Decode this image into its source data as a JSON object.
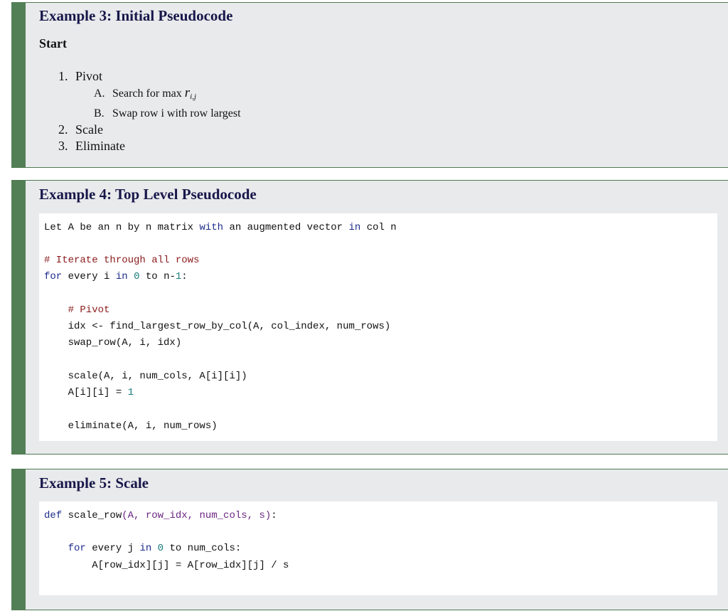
{
  "example3": {
    "title": "Example 3: Initial Pseudocode",
    "start_label": "Start",
    "steps": [
      {
        "num": "1.",
        "label": "Pivot",
        "substeps": [
          {
            "num": "A.",
            "label": "Search for max ",
            "var": "r",
            "sub": "i,j"
          },
          {
            "num": "B.",
            "label": "Swap row i with row largest"
          }
        ]
      },
      {
        "num": "2.",
        "label": "Scale"
      },
      {
        "num": "3.",
        "label": "Eliminate"
      }
    ]
  },
  "example4": {
    "title": "Example 4: Top Level Pseudocode",
    "code": {
      "l1a": "Let A be an n by n matrix ",
      "l1b": "with",
      "l1c": " an augmented vector ",
      "l1d": "in",
      "l1e": " col n",
      "l2": "# Iterate through all rows",
      "l3a": "for",
      "l3b": " every i ",
      "l3c": "in",
      "l3d": " ",
      "l3e": "0",
      "l3f": " to n-",
      "l3g": "1",
      "l3h": ":",
      "l4": "    # Pivot",
      "l5": "    idx <- find_largest_row_by_col(A, col_index, num_rows)",
      "l6": "    swap_row(A, i, idx)",
      "l7": "    scale(A, i, num_cols, A[i][i])",
      "l8a": "    A[i][i] = ",
      "l8b": "1",
      "l9": "    eliminate(A, i, num_rows)"
    }
  },
  "example5": {
    "title": "Example 5: Scale",
    "code": {
      "l1a": "def",
      "l1b": " scale_row",
      "l1c": "(A, row_idx, num_cols, s)",
      "l1d": ":",
      "l2a": "    for",
      "l2b": " every j ",
      "l2c": "in",
      "l2d": " ",
      "l2e": "0",
      "l2f": " to num_cols:",
      "l3": "        A[row_idx][j] = A[row_idx][j] / s"
    }
  }
}
